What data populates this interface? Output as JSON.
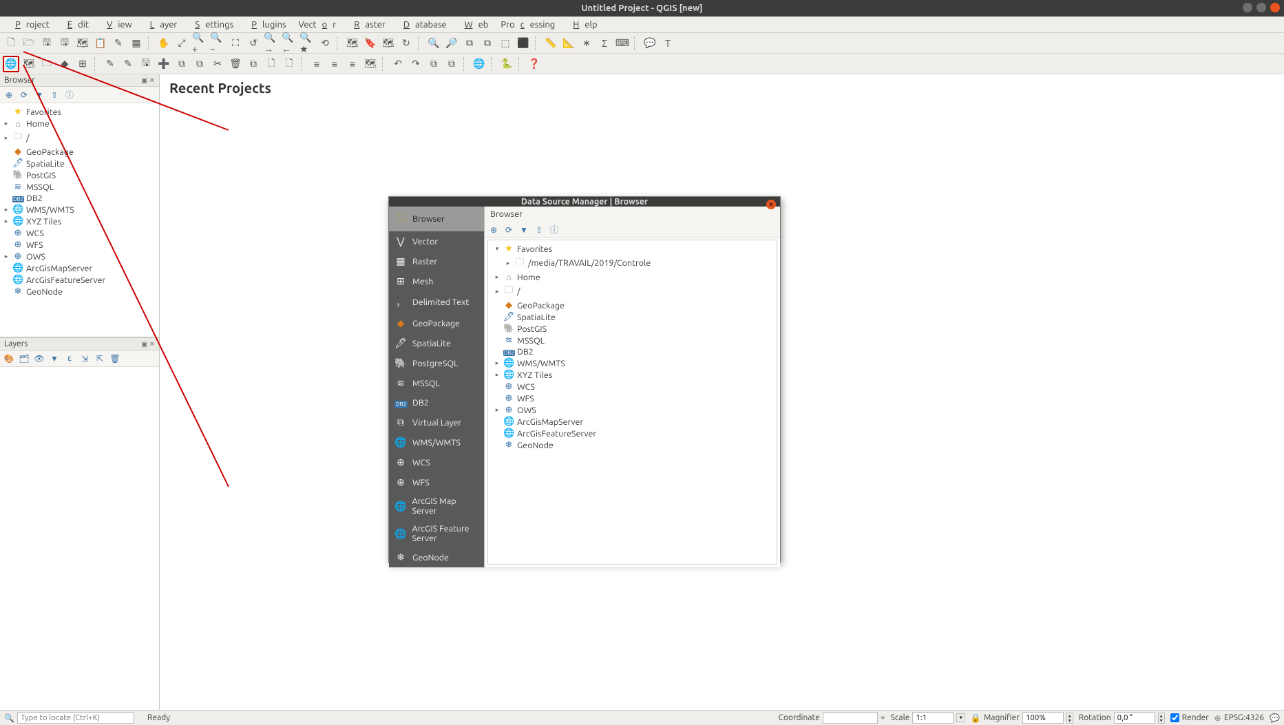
{
  "title": "Untitled Project - QGIS [new]",
  "menu": [
    "Project",
    "Edit",
    "View",
    "Layer",
    "Settings",
    "Plugins",
    "Vector",
    "Raster",
    "Database",
    "Web",
    "Processing",
    "Help"
  ],
  "menu_keys": [
    "P",
    "E",
    "V",
    "L",
    "S",
    "P",
    "o",
    "R",
    "D",
    "W",
    "c",
    "H"
  ],
  "heading": "Recent Projects",
  "browser_panel": {
    "title": "Browser",
    "items": [
      {
        "arrow": "",
        "icon": "★",
        "cls": "c-star",
        "label": "Favorites"
      },
      {
        "arrow": "▸",
        "icon": "⌂",
        "cls": "c-gray",
        "label": "Home"
      },
      {
        "arrow": "▸",
        "icon": "🗀",
        "cls": "c-gray",
        "label": "/"
      },
      {
        "arrow": "",
        "icon": "◆",
        "cls": "c-orange",
        "label": "GeoPackage"
      },
      {
        "arrow": "",
        "icon": "🖊",
        "cls": "c-blue",
        "label": "SpatiaLite"
      },
      {
        "arrow": "",
        "icon": "🐘",
        "cls": "c-blue",
        "label": "PostGIS"
      },
      {
        "arrow": "",
        "icon": "≋",
        "cls": "c-blue",
        "label": "MSSQL"
      },
      {
        "arrow": "",
        "icon": "DB2",
        "cls": "c-blue",
        "label": "DB2"
      },
      {
        "arrow": "▸",
        "icon": "🌐",
        "cls": "c-blue",
        "label": "WMS/WMTS"
      },
      {
        "arrow": "▸",
        "icon": "🌐",
        "cls": "c-blue",
        "label": "XYZ Tiles"
      },
      {
        "arrow": "",
        "icon": "⊕",
        "cls": "c-blue",
        "label": "WCS"
      },
      {
        "arrow": "",
        "icon": "⊕",
        "cls": "c-blue",
        "label": "WFS"
      },
      {
        "arrow": "▸",
        "icon": "⊕",
        "cls": "c-blue",
        "label": "OWS"
      },
      {
        "arrow": "",
        "icon": "🌐",
        "cls": "c-blue",
        "label": "ArcGisMapServer"
      },
      {
        "arrow": "",
        "icon": "🌐",
        "cls": "c-blue",
        "label": "ArcGisFeatureServer"
      },
      {
        "arrow": "",
        "icon": "❄",
        "cls": "c-blue",
        "label": "GeoNode"
      }
    ]
  },
  "layers_panel": {
    "title": "Layers"
  },
  "dialog": {
    "title": "Data Source Manager | Browser",
    "side_items": [
      {
        "icon": "🗀",
        "label": "Browser",
        "sel": true,
        "cls": "c-yellow"
      },
      {
        "icon": "⋁",
        "label": "Vector",
        "cls": ""
      },
      {
        "icon": "▦",
        "label": "Raster",
        "cls": ""
      },
      {
        "icon": "⊞",
        "label": "Mesh",
        "cls": ""
      },
      {
        "icon": "，",
        "label": "Delimited Text",
        "cls": ""
      },
      {
        "icon": "◆",
        "label": "GeoPackage",
        "cls": "c-orange"
      },
      {
        "icon": "🖊",
        "label": "SpatiaLite",
        "cls": ""
      },
      {
        "icon": "🐘",
        "label": "PostgreSQL",
        "cls": ""
      },
      {
        "icon": "≋",
        "label": "MSSQL",
        "cls": ""
      },
      {
        "icon": "DB2",
        "label": "DB2",
        "cls": ""
      },
      {
        "icon": "⧉",
        "label": "Virtual Layer",
        "cls": ""
      },
      {
        "icon": "🌐",
        "label": "WMS/WMTS",
        "cls": ""
      },
      {
        "icon": "⊕",
        "label": "WCS",
        "cls": ""
      },
      {
        "icon": "⊕",
        "label": "WFS",
        "cls": ""
      },
      {
        "icon": "🌐",
        "label": "ArcGIS Map Server",
        "cls": ""
      },
      {
        "icon": "🌐",
        "label": "ArcGIS Feature Server",
        "cls": ""
      },
      {
        "icon": "❄",
        "label": "GeoNode",
        "cls": ""
      }
    ],
    "main_title": "Browser",
    "tree": [
      {
        "indent": 0,
        "arrow": "▾",
        "icon": "★",
        "cls": "c-star",
        "label": "Favorites"
      },
      {
        "indent": 1,
        "arrow": "▸",
        "icon": "🗀",
        "cls": "c-gray",
        "label": "/media/TRAVAIL/2019/Controle"
      },
      {
        "indent": 0,
        "arrow": "▸",
        "icon": "⌂",
        "cls": "c-gray",
        "label": "Home"
      },
      {
        "indent": 0,
        "arrow": "▸",
        "icon": "🗀",
        "cls": "c-gray",
        "label": "/"
      },
      {
        "indent": 0,
        "arrow": "",
        "icon": "◆",
        "cls": "c-orange",
        "label": "GeoPackage"
      },
      {
        "indent": 0,
        "arrow": "",
        "icon": "🖊",
        "cls": "c-blue",
        "label": "SpatiaLite"
      },
      {
        "indent": 0,
        "arrow": "",
        "icon": "🐘",
        "cls": "c-blue",
        "label": "PostGIS"
      },
      {
        "indent": 0,
        "arrow": "",
        "icon": "≋",
        "cls": "c-blue",
        "label": "MSSQL"
      },
      {
        "indent": 0,
        "arrow": "",
        "icon": "DB2",
        "cls": "c-blue",
        "label": "DB2"
      },
      {
        "indent": 0,
        "arrow": "▸",
        "icon": "🌐",
        "cls": "c-blue",
        "label": "WMS/WMTS"
      },
      {
        "indent": 0,
        "arrow": "▸",
        "icon": "🌐",
        "cls": "c-blue",
        "label": "XYZ Tiles"
      },
      {
        "indent": 0,
        "arrow": "",
        "icon": "⊕",
        "cls": "c-blue",
        "label": "WCS"
      },
      {
        "indent": 0,
        "arrow": "",
        "icon": "⊕",
        "cls": "c-blue",
        "label": "WFS"
      },
      {
        "indent": 0,
        "arrow": "▸",
        "icon": "⊕",
        "cls": "c-blue",
        "label": "OWS"
      },
      {
        "indent": 0,
        "arrow": "",
        "icon": "🌐",
        "cls": "c-blue",
        "label": "ArcGisMapServer"
      },
      {
        "indent": 0,
        "arrow": "",
        "icon": "🌐",
        "cls": "c-blue",
        "label": "ArcGisFeatureServer"
      },
      {
        "indent": 0,
        "arrow": "",
        "icon": "❄",
        "cls": "c-blue",
        "label": "GeoNode"
      }
    ]
  },
  "statusbar": {
    "locator_placeholder": "Type to locate (Ctrl+K)",
    "ready": "Ready",
    "coord_label": "Coordinate",
    "coord_value": "",
    "scale_label": "Scale",
    "scale_value": "1:1",
    "mag_label": "Magnifier",
    "mag_value": "100%",
    "rot_label": "Rotation",
    "rot_value": "0,0 °",
    "render_label": "Render",
    "crs": "EPSG:4326"
  },
  "toolbar1_icons": [
    "🗋",
    "🗁",
    "🖫",
    "🖫",
    "🗺",
    "📋",
    "✎",
    "▦",
    "|",
    "✋",
    "⤢",
    "🔍+",
    "🔍−",
    "⛶",
    "↺",
    "🔍→",
    "🔍←",
    "🔍★",
    "⟲",
    "|",
    "🗺",
    "🔖",
    "🗺",
    "↻",
    "|",
    "🔍",
    "🔎",
    "⧉",
    "⧉",
    "⬚",
    "⬛",
    "|",
    "📏",
    "📐",
    "∗",
    "Σ",
    "⌨",
    "|",
    "💬",
    "T"
  ],
  "toolbar2_icons": [
    "🌐",
    "🗺",
    "🗀",
    "◆",
    "⊞",
    "|",
    "✎",
    "✎",
    "🖫",
    "➕",
    "⧉",
    "⧉",
    "✂",
    "🗑",
    "⧉",
    "🗋",
    "🗋",
    "|",
    "≡",
    "≡",
    "≡",
    "🗺",
    "|",
    "↶",
    "↷",
    "⧉",
    "⧉",
    "|",
    "🌐",
    "|",
    "🐍",
    "|",
    "❓"
  ]
}
